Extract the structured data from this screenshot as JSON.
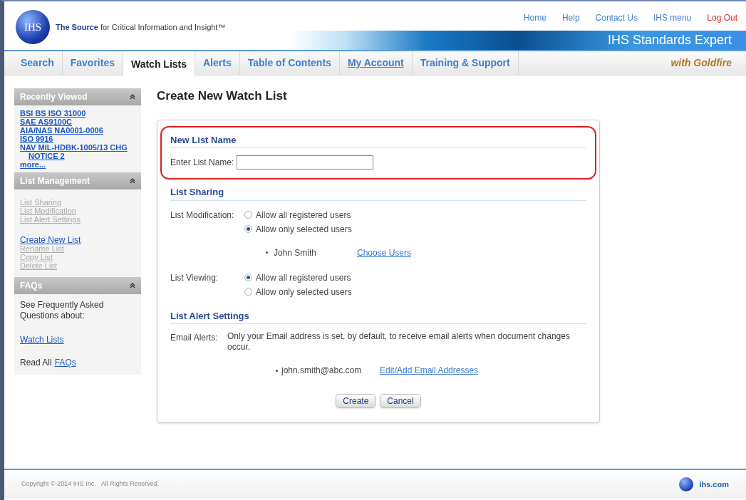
{
  "header": {
    "logo": "IHS",
    "tagline": "**The Source** for Critical Information and Insight™",
    "links": [
      {
        "label": "Home",
        "kind": "normal"
      },
      {
        "label": "Help",
        "kind": "normal"
      },
      {
        "label": "Contact Us",
        "kind": "normal"
      },
      {
        "label": "IHS menu",
        "kind": "normal"
      },
      {
        "label": "Log Out",
        "kind": "logout"
      }
    ],
    "product": "IHS Standards Expert"
  },
  "tabs": [
    {
      "label": "Search",
      "selected": false,
      "underlined": false
    },
    {
      "label": "Favorites",
      "selected": false,
      "underlined": false
    },
    {
      "label": "Watch Lists",
      "selected": true,
      "underlined": false
    },
    {
      "label": "Alerts",
      "selected": false,
      "underlined": false
    },
    {
      "label": "Table of Contents",
      "selected": false,
      "underlined": false
    },
    {
      "label": "My Account",
      "selected": false,
      "underlined": true
    },
    {
      "label": "Training & Support",
      "selected": false,
      "underlined": false
    }
  ],
  "tab_tagline": "with Goldfire",
  "sidebar": [
    {
      "title": "Recently Viewed",
      "kind": "links",
      "items": [
        {
          "label": "BSI BS ISO 31000",
          "disabled": false,
          "indented": false
        },
        {
          "label": "SAE AS9100C",
          "disabled": false,
          "indented": false
        },
        {
          "label": "AIA/NAS NA0001-0006",
          "disabled": false,
          "indented": false
        },
        {
          "label": "ISO 9916",
          "disabled": false,
          "indented": false
        },
        {
          "label": "NAV MIL-HDBK-1005/13 CHG",
          "disabled": false,
          "indented": false
        },
        {
          "label": "NOTICE 2",
          "disabled": false,
          "indented": true
        },
        {
          "label": "more...",
          "disabled": false,
          "indented": false
        }
      ]
    },
    {
      "title": "List Management",
      "kind": "groups",
      "groups": [
        [
          {
            "label": "List Sharing",
            "disabled": true
          },
          {
            "label": "List Modification",
            "disabled": true
          },
          {
            "label": "List Alert Settings",
            "disabled": true
          }
        ],
        [
          {
            "label": "Create New List",
            "disabled": false
          },
          {
            "label": "Rename List",
            "disabled": true
          },
          {
            "label": "Copy List",
            "disabled": true
          },
          {
            "label": "Delete List",
            "disabled": true
          }
        ]
      ]
    },
    {
      "title": "FAQs",
      "kind": "faq",
      "intro": "See Frequently Asked Questions about:",
      "link": "Watch Lists",
      "read_all": "Read All",
      "read_all_link": "FAQs"
    }
  ],
  "page_title": "Create New Watch List",
  "sections": [
    {
      "title": "New List Name",
      "highlighted": true,
      "kind": "name",
      "label": "Enter List Name:"
    },
    {
      "title": "List Sharing",
      "highlighted": false,
      "kind": "sharing",
      "groups": [
        {
          "label": "List Modification:",
          "options": [
            {
              "label": "Allow all registered users",
              "selected": false
            },
            {
              "label": "Allow only selected users",
              "selected": true
            }
          ],
          "user": "John Smith",
          "link": "Choose Users"
        },
        {
          "label": "List Viewing:",
          "options": [
            {
              "label": "Allow all registered users",
              "selected": true
            },
            {
              "label": "Allow only selected users",
              "selected": false
            }
          ]
        }
      ]
    },
    {
      "title": "List Alert Settings",
      "highlighted": false,
      "kind": "alerts",
      "label": "Email Alerts:",
      "text": "Only your Email address is set, by default, to receive email alerts when document changes occur.",
      "email": "john.smith@abc.com",
      "link": "Edit/Add Email Addresses"
    }
  ],
  "buttons": [
    "Create",
    "Cancel"
  ],
  "footer": {
    "copyright": "Copyright © 2014 IHS Inc.   All Rights Reserved.",
    "logo_text": "ihs.com"
  }
}
